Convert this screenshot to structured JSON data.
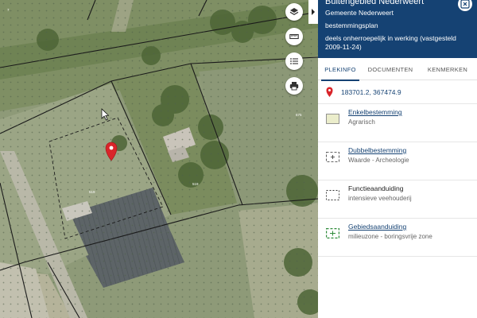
{
  "colors": {
    "header_bg": "#154273",
    "link": "#154273",
    "enkel_swatch": "#ebedcb",
    "gebied_swatch": "#2e8b3a",
    "marker": "#d9252a",
    "plan_lines": "#1a1a1a",
    "map_dots": "#5b6b52"
  },
  "map": {
    "parcel_labels": [
      "675",
      "519",
      "519",
      "7"
    ],
    "tools": [
      {
        "name": "layers-icon"
      },
      {
        "name": "ruler-icon"
      },
      {
        "name": "list-icon"
      },
      {
        "name": "print-icon"
      }
    ]
  },
  "panel": {
    "title": "Buitengebied Nederweert",
    "municipality": "Gemeente Nederweert",
    "plan_type": "bestemmingsplan",
    "status": "deels onherroepelijk in werking (vastgesteld 2009-11-24)",
    "tabs": [
      "PLEKINFO",
      "DOCUMENTEN",
      "KENMERKEN"
    ],
    "active_tab": "PLEKINFO",
    "coordinates": "183701.2, 367474.9",
    "items": [
      {
        "title": "Enkelbestemming",
        "subtitle": "Agrarisch",
        "icon": "enkelbestemming-swatch-icon"
      },
      {
        "title": "Dubbelbestemming",
        "subtitle": "Waarde - Archeologie",
        "icon": "dubbelbestemming-icon"
      },
      {
        "title": "Functieaanduiding",
        "subtitle": "intensieve veehouderij",
        "icon": "functieaanduiding-icon"
      },
      {
        "title": "Gebiedsaanduiding",
        "subtitle": "milieuzone - boringsvrije zone",
        "icon": "gebiedsaanduiding-icon"
      }
    ]
  }
}
